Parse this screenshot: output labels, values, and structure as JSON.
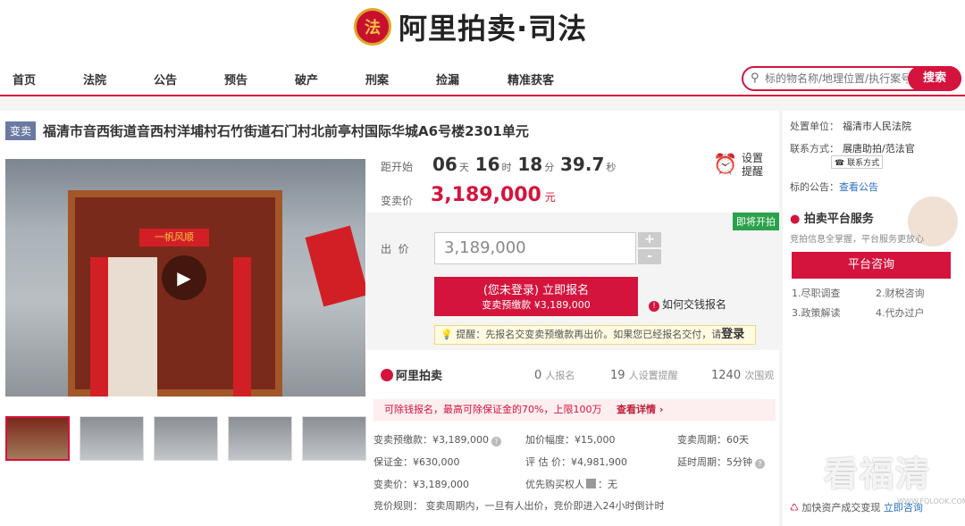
{
  "header": {
    "logo_text": "阿里拍卖·司法",
    "emblem": "法"
  },
  "nav": [
    "首页",
    "法院",
    "公告",
    "预告",
    "破产",
    "刑案",
    "捡漏",
    "精准获客"
  ],
  "search": {
    "placeholder": "标的物名称/地理位置/执行案号",
    "button": "搜索"
  },
  "item": {
    "tag": "变卖",
    "title": "福清市音西街道音西村洋埔村石竹街道石门村北前亭村国际华城A6号楼2301单元",
    "banner_text": "一帆风顺"
  },
  "countdown": {
    "label": "距开始",
    "days": "06",
    "days_unit": "天",
    "hours": "16",
    "hours_unit": "时",
    "minutes": "18",
    "minutes_unit": "分",
    "seconds": "39.7",
    "seconds_unit": "秒"
  },
  "remind": {
    "line1": "设置",
    "line2": "提醒"
  },
  "price": {
    "label": "变卖价",
    "value": "3,189,000",
    "unit": "元"
  },
  "bid": {
    "soon_badge": "即将开拍",
    "label": "出  价",
    "value": "3,189,000",
    "plus": "+",
    "minus": "-",
    "signup_line1": "(您未登录) 立即报名",
    "signup_line2": "变卖预缴款 ¥3,189,000",
    "howpay": "如何交钱报名",
    "tip": "提醒：先报名交变卖预缴款再出价。如果您已经报名交付，请",
    "tip_login": "登录"
  },
  "stats": {
    "logo": "阿里拍卖",
    "signups": "0",
    "signups_label": "人报名",
    "reminders": "19",
    "reminders_label": "人设置提醒",
    "views": "1240",
    "views_label": "次围观"
  },
  "deposit_note": {
    "text": "可除钱报名，最高可除保证金的70%，上限100万",
    "more": "查看详情 ›"
  },
  "details": {
    "prepay": "变卖预缴款：¥3,189,000",
    "increment": "加价幅度：¥15,000",
    "period": "变卖周期：60天",
    "deposit": "保证金：¥630,000",
    "appraisal": "评 估 价：¥4,981,900",
    "delay": "延时周期：5分钟",
    "sale_price": "变卖价：¥3,189,000",
    "priority": "优先购买权人",
    "priority_value": "：无",
    "rule": "竞价规则：  变卖周期内，一旦有人出价，竞价即进入24小时倒计时"
  },
  "side": {
    "unit_label": "处置单位：",
    "unit_value": "福清市人民法院",
    "contact_label": "联系方式：",
    "contact_value": "展唐助拍/范法官",
    "contact_btn": "联系方式",
    "notice_label": "标的公告：",
    "notice_link": "查看公告",
    "service_title": "拍卖平台服务",
    "service_sub": "竞拍信息全掌握，平台服务更放心",
    "consult_btn": "平台咨询",
    "svc": [
      "1.尽职调查",
      "2.财税咨询",
      "3.政策解读",
      "4.代办过户"
    ],
    "promo": "加快资产成交变现",
    "promo_link": "立即咨询"
  },
  "watermark": {
    "text": "看福清",
    "url": "WWW.FQLOOK.COM"
  },
  "colors": {
    "brand": "#d4143d",
    "tag": "#6b7aa3",
    "badge": "#2aa14a"
  }
}
